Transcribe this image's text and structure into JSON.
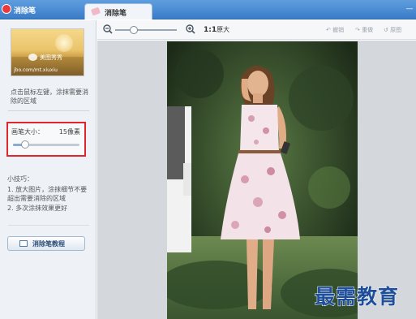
{
  "window": {
    "app_title": "消除笔",
    "tab_label": "消除笔",
    "minimize_glyph": "—"
  },
  "sidebar": {
    "thumbnail": {
      "watermark": "美图秀秀",
      "url": "jbo.com/mt.xiuxiu"
    },
    "description": "点击鼠标左键，涂抹需要消除的区域",
    "brush_size": {
      "label": "画笔大小：",
      "value_text": "15像素",
      "slider_fraction": 0.18
    },
    "tips": {
      "title": "小技巧：",
      "items": [
        "1. 放大图片，涂抹细节不要超出需要消除的区域",
        "2. 多次涂抹效果更好"
      ]
    },
    "tutorial_button": "消除笔教程"
  },
  "toolbar": {
    "zoom_fraction": 0.3,
    "ratio_label": "1:1",
    "ratio_suffix": "原大",
    "undo_label": "撤销",
    "redo_label": "重做",
    "reset_label": "原图"
  },
  "watermark": "最需教育",
  "colors": {
    "title_bar": "#3a7cc8",
    "highlight_border": "#e0262a",
    "watermark": "#1f4f9a"
  }
}
